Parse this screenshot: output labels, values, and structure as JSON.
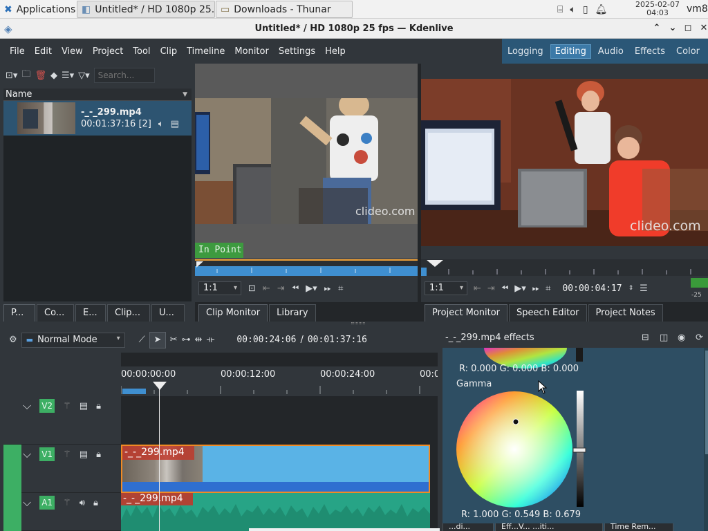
{
  "taskbar": {
    "applications": "Applications",
    "windows": [
      {
        "label": "Untitled* / HD 1080p 25...",
        "active": true
      },
      {
        "label": "Downloads - Thunar",
        "active": false
      }
    ],
    "date": "2025-02-07",
    "time": "04:03",
    "user": "vm8"
  },
  "window": {
    "title": "Untitled* / HD 1080p 25 fps — Kdenlive"
  },
  "menu": [
    "File",
    "Edit",
    "View",
    "Project",
    "Tool",
    "Clip",
    "Timeline",
    "Monitor",
    "Settings",
    "Help"
  ],
  "layouts": [
    {
      "label": "Logging",
      "active": false
    },
    {
      "label": "Editing",
      "active": true
    },
    {
      "label": "Audio",
      "active": false
    },
    {
      "label": "Effects",
      "active": false
    },
    {
      "label": "Color",
      "active": false
    }
  ],
  "bin": {
    "search_placeholder": "Search...",
    "column_header": "Name",
    "clip": {
      "name": "-_-_299.mp4",
      "info": "00:01:37:16 [2]"
    },
    "tabs": [
      "P...",
      "Co...",
      "E...",
      "Clip...",
      "U..."
    ]
  },
  "clip_monitor": {
    "watermark": "clideo.com",
    "in_point": "In Point",
    "zoom": "1:1",
    "tabs": [
      "Clip Monitor",
      "Library"
    ]
  },
  "project_monitor": {
    "watermark": "clideo.com",
    "zoom": "1:1",
    "timecode": "00:00:04:17",
    "meter": "-25",
    "tabs": [
      "Project Monitor",
      "Speech Editor",
      "Project Notes"
    ]
  },
  "timeline": {
    "mode": "Normal Mode",
    "position": "00:00:24:06",
    "separator": "/",
    "duration": "00:01:37:16",
    "ruler": [
      "00:00:00:00",
      "00:00:12:00",
      "00:00:24:00",
      "00:0"
    ],
    "tracks": [
      {
        "name": "V2"
      },
      {
        "name": "V1",
        "clip": "-_-_299.mp4"
      },
      {
        "name": "A1",
        "clip": "-_-_299.mp4"
      }
    ]
  },
  "effects": {
    "title": "-_-_299.mp4 effects",
    "lift_values": "R: 0.000   G: 0.000   B: 0.000",
    "gamma_label": "Gamma",
    "gamma_values": "R: 1.000   G: 0.549   B: 0.679",
    "bottom_tabs": [
      "...di...",
      "Eff...V... ...iti...",
      "Time Rem..."
    ]
  }
}
